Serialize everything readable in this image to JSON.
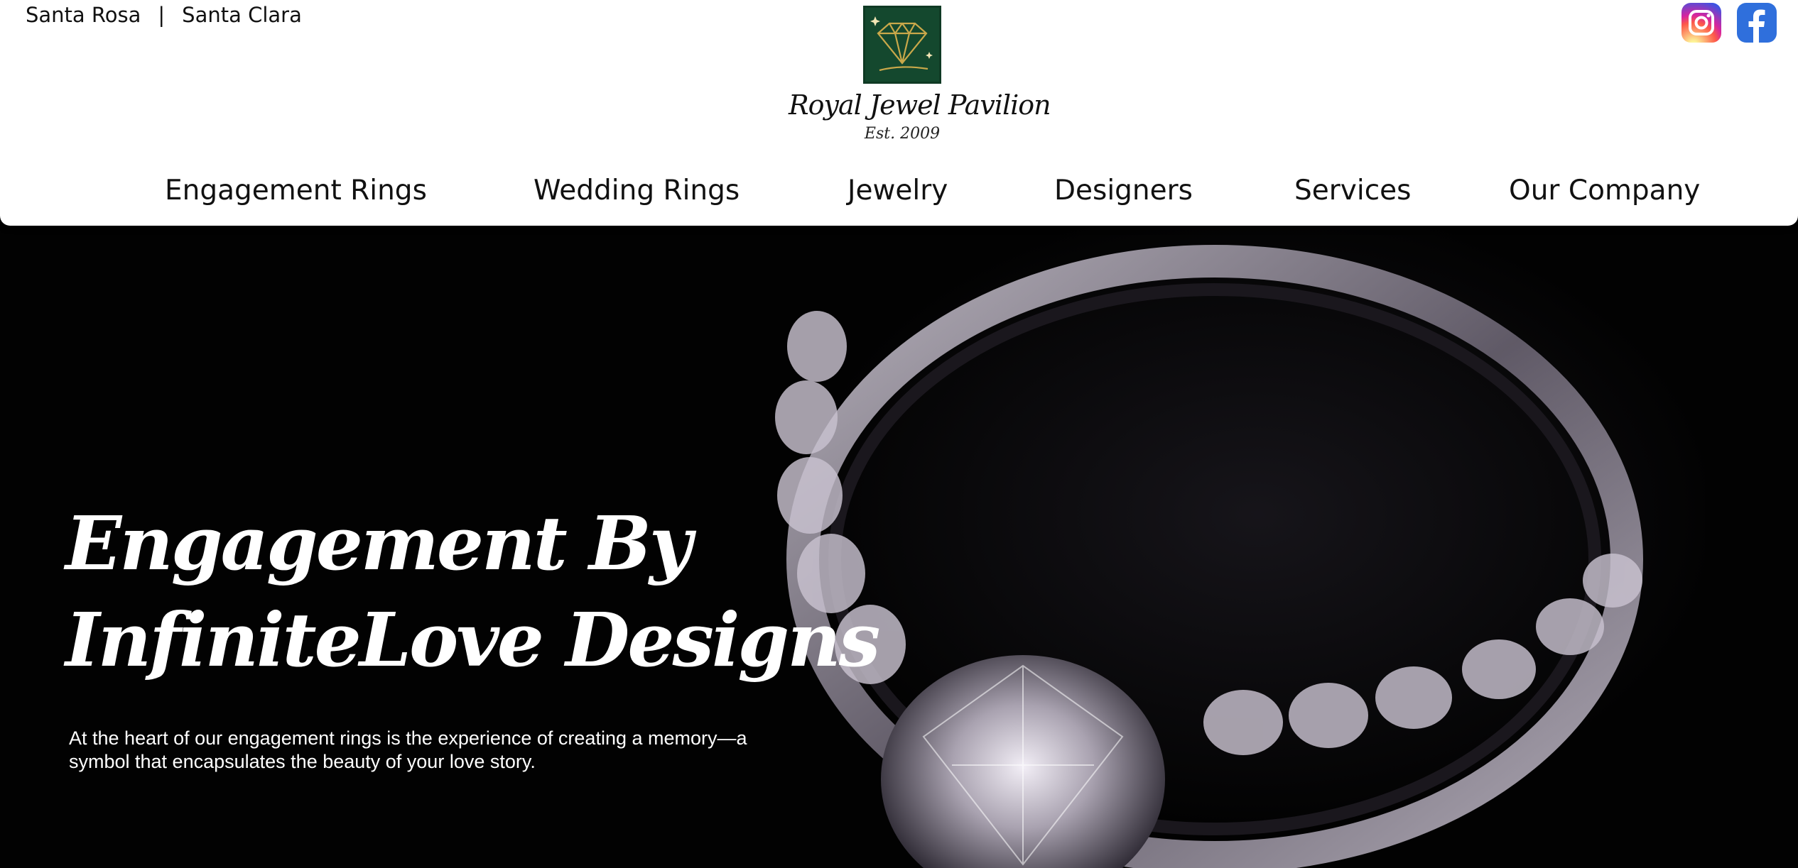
{
  "header": {
    "locations": [
      "Santa Rosa",
      "Santa Clara"
    ],
    "separator": "|",
    "brand_name": "Royal Jewel Pavilion",
    "brand_est": "Est. 2009",
    "social": [
      {
        "name": "instagram-icon"
      },
      {
        "name": "facebook-icon"
      }
    ]
  },
  "nav": {
    "items": [
      {
        "label": "Engagement Rings"
      },
      {
        "label": "Wedding Rings"
      },
      {
        "label": "Jewelry"
      },
      {
        "label": "Designers"
      },
      {
        "label": "Services"
      },
      {
        "label": "Our Company"
      }
    ]
  },
  "hero": {
    "title_line1": "Engagement By",
    "title_line2": "InfiniteLove Designs",
    "text": "At the heart of our engagement rings is the experience of creating a memory—a symbol that encapsulates the beauty of your love story."
  },
  "colors": {
    "logo_bg": "#14482e",
    "logo_gold": "#c9a84a",
    "hero_bg": "#020202"
  }
}
